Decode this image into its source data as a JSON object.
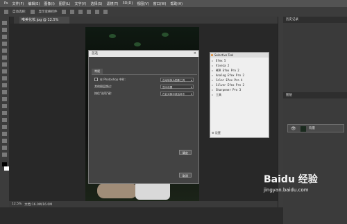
{
  "app": {
    "menu": [
      "Ps",
      "文件(F)",
      "编辑(E)",
      "图像(I)",
      "图层(L)",
      "文字(Y)",
      "选择(S)",
      "滤镜(T)",
      "3D(D)",
      "视图(V)",
      "窗口(W)",
      "帮助(H)"
    ],
    "options_bar": [
      "自动选择:",
      "显示变换控件"
    ]
  },
  "document": {
    "tab_title": "唯美化妆.jpg @ 12.5%(RGB/8)",
    "status_left": "12.5%",
    "status_right": "文档:16.0M/16.0M"
  },
  "dialog": {
    "title": "首选",
    "tab_label": "常规",
    "rows": [
      {
        "label": "在 Photoshop 中时:",
        "value": "自动转换为图像工具"
      },
      {
        "label": "其他图层跳过:",
        "value": "显示设置"
      },
      {
        "label": "按住\"选项\"键:",
        "value": "在此对象中激活命令"
      }
    ],
    "ok_label": "确定",
    "cancel_label": "取消"
  },
  "filter_panel": {
    "title": "Selective Tool",
    "items": [
      "Efex 5",
      "Viveza 2",
      "HDR Efex Pro 2",
      "Analog Efex Pro 2",
      "Color Efex Pro 4",
      "Silver Efex Pro 2",
      "Sharpener Pro 3",
      "工具"
    ],
    "footer": "设置"
  },
  "right_panels": {
    "history_title": "历史记录",
    "layers_title": "图层",
    "layer_name": "背景"
  },
  "watermark": {
    "brand": "Baidu 经验",
    "url": "jingyan.baidu.com"
  }
}
